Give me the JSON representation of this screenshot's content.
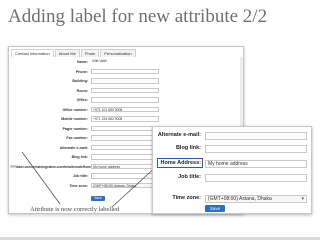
{
  "slide": {
    "title": "Adding label for new attribute 2/2",
    "caption": "Attribute is now correctly labelled"
  },
  "panel": {
    "tabs": [
      "Contact information",
      "About Me",
      "Photo",
      "Personalization"
    ],
    "rows": [
      {
        "label": "Name:",
        "value": "Ville Valtti",
        "kind": "plain"
      },
      {
        "label": "Phone:",
        "value": "",
        "kind": "text"
      },
      {
        "label": "Building:",
        "value": "",
        "kind": "text"
      },
      {
        "label": "Room:",
        "value": "",
        "kind": "text"
      },
      {
        "label": "Office:",
        "value": "",
        "kind": "text"
      },
      {
        "label": "Office number:",
        "value": "+971 101 880 9008",
        "kind": "text"
      },
      {
        "label": "Mobile number:",
        "value": "+971 234 882 9008",
        "kind": "text"
      },
      {
        "label": "Pager number:",
        "value": "",
        "kind": "text"
      },
      {
        "label": "Fax number:",
        "value": "",
        "kind": "text"
      },
      {
        "label": "Alternate e-mail:",
        "value": "",
        "kind": "text"
      },
      {
        "label": "Blog link:",
        "value": "",
        "kind": "text"
      },
      {
        "label": "",
        "value": "My home address",
        "kind": "text"
      },
      {
        "label": "Job title:",
        "value": "",
        "kind": "text"
      },
      {
        "label": "Time zone:",
        "value": "(GMT+08:00) Astana, Dhaka",
        "kind": "select"
      }
    ],
    "long_label": "???label.com/orbsIntegration.usertm/alternateHomeAddress???",
    "save_label": "Save"
  },
  "inset": {
    "rows": [
      {
        "label": "Alternate e-mail:",
        "value": "",
        "kind": "text"
      },
      {
        "label": "Blog link:",
        "value": "",
        "kind": "text"
      },
      {
        "label": "Home Address:",
        "value": "My home address",
        "kind": "text"
      },
      {
        "label": "Job title:",
        "value": "",
        "kind": "text"
      },
      {
        "label": "",
        "value": "",
        "kind": "gap"
      },
      {
        "label": "Time zone:",
        "value": "(GMT+08:00) Astana, Dhaka",
        "kind": "select"
      }
    ],
    "save_label": "Save"
  },
  "colors": {
    "highlight": "#2a5fb5",
    "save_button": "#2f6ec6",
    "title_text": "#6f6f6f"
  }
}
